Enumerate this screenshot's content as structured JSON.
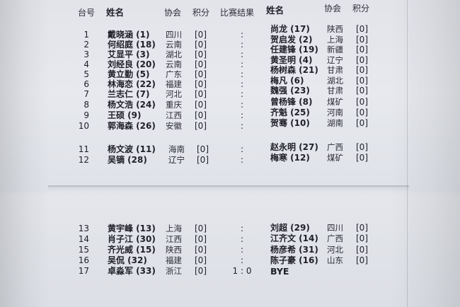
{
  "header": {
    "board": "台号",
    "name": "姓名",
    "assoc": "协会",
    "points": "积分",
    "result": "比赛结果",
    "name2": "姓名",
    "assoc2": "协会",
    "points2": "积分"
  },
  "rows": [
    {
      "board": "1",
      "white": "戴晓涵 (1)",
      "white_assoc": "四川",
      "white_pts": "[0]",
      "result": ":",
      "black": "尚龙 (17)",
      "black_assoc": "陕西",
      "black_pts": "[0]"
    },
    {
      "board": "2",
      "white": "何绍庭 (18)",
      "white_assoc": "云南",
      "white_pts": "[0]",
      "result": ":",
      "black": "贺启发 (2)",
      "black_assoc": "上海",
      "black_pts": "[0]"
    },
    {
      "board": "3",
      "white": "艾显平 (3)",
      "white_assoc": "湖北",
      "white_pts": "[0]",
      "result": ":",
      "black": "任建锋 (19)",
      "black_assoc": "新疆",
      "black_pts": "[0]"
    },
    {
      "board": "4",
      "white": "刘经良 (20)",
      "white_assoc": "云南",
      "white_pts": "[0]",
      "result": ":",
      "black": "黄圣明 (4)",
      "black_assoc": "辽宁",
      "black_pts": "[0]"
    },
    {
      "board": "5",
      "white": "黄立勤 (5)",
      "white_assoc": "广东",
      "white_pts": "[0]",
      "result": ":",
      "black": "杨树森 (21)",
      "black_assoc": "甘肃",
      "black_pts": "[0]"
    },
    {
      "board": "6",
      "white": "林海恋 (22)",
      "white_assoc": "福建",
      "white_pts": "[0]",
      "result": ":",
      "black": "梅凡 (6)",
      "black_assoc": "湖北",
      "black_pts": "[0]"
    },
    {
      "board": "7",
      "white": "兰志仁 (7)",
      "white_assoc": "河北",
      "white_pts": "[0]",
      "result": ":",
      "black": "魏强 (23)",
      "black_assoc": "甘肃",
      "black_pts": "[0]"
    },
    {
      "board": "8",
      "white": "杨文浩 (24)",
      "white_assoc": "重庆",
      "white_pts": "[0]",
      "result": ":",
      "black": "曾杨锋 (8)",
      "black_assoc": "煤矿",
      "black_pts": "[0]"
    },
    {
      "board": "9",
      "white": "王硕 (9)",
      "white_assoc": "江西",
      "white_pts": "[0]",
      "result": ":",
      "black": "齐魁 (25)",
      "black_assoc": "河南",
      "black_pts": "[0]"
    },
    {
      "board": "10",
      "white": "郭海森 (26)",
      "white_assoc": "安徽",
      "white_pts": "[0]",
      "result": ":",
      "black": "贺骞 (10)",
      "black_assoc": "湖南",
      "black_pts": "[0]"
    },
    {
      "board": "11",
      "white": "杨文波 (11)",
      "white_assoc": "海南",
      "white_pts": "[0]",
      "result": ":",
      "black": "赵永明 (27)",
      "black_assoc": "广西",
      "black_pts": "[0]"
    },
    {
      "board": "12",
      "white": "吴镝 (28)",
      "white_assoc": "辽宁",
      "white_pts": "[0]",
      "result": ":",
      "black": "梅寒 (12)",
      "black_assoc": "煤矿",
      "black_pts": "[0]"
    },
    {
      "board": "13",
      "white": "黄宇峰 (13)",
      "white_assoc": "上海",
      "white_pts": "[0]",
      "result": ":",
      "black": "刘超 (29)",
      "black_assoc": "四川",
      "black_pts": "[0]"
    },
    {
      "board": "14",
      "white": "肖子江 (30)",
      "white_assoc": "江西",
      "white_pts": "[0]",
      "result": ":",
      "black": "江齐文 (14)",
      "black_assoc": "广西",
      "black_pts": "[0]"
    },
    {
      "board": "15",
      "white": "齐光威 (15)",
      "white_assoc": "陕西",
      "white_pts": "[0]",
      "result": ":",
      "black": "杨彦希 (31)",
      "black_assoc": "河北",
      "black_pts": "[0]"
    },
    {
      "board": "16",
      "white": "吴侃 (32)",
      "white_assoc": "福建",
      "white_pts": "[0]",
      "result": ":",
      "black": "陈子豪 (16)",
      "black_assoc": "山东",
      "black_pts": "[0]"
    },
    {
      "board": "17",
      "white": "卓淼军 (33)",
      "white_assoc": "浙江",
      "white_pts": "[0]",
      "result": "1 : 0",
      "black": "BYE",
      "black_assoc": "",
      "black_pts": ""
    }
  ]
}
